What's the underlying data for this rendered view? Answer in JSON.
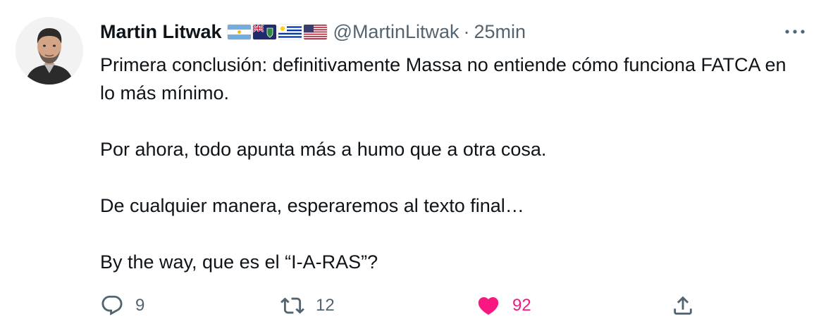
{
  "user": {
    "name": "Martin Litwak",
    "flags": [
      {
        "name": "argentina-flag-icon",
        "country": "Argentina"
      },
      {
        "name": "british-virgin-islands-flag-icon",
        "country": "British Virgin Islands"
      },
      {
        "name": "uruguay-flag-icon",
        "country": "Uruguay"
      },
      {
        "name": "united-states-flag-icon",
        "country": "United States"
      }
    ],
    "handle": "@MartinLitwak",
    "separator": "·",
    "time": "25min"
  },
  "tweet": {
    "paragraphs": [
      "Primera conclusión: definitivamente Massa no entiende cómo funciona FATCA en lo más mínimo.",
      "Por ahora, todo apunta más a humo que a otra cosa.",
      "De cualquier manera, esperaremos al texto final…",
      "By the way, que es el “I-A-RAS”?"
    ]
  },
  "actions": {
    "reply_count": "9",
    "retweet_count": "12",
    "like_count": "92",
    "liked": true
  },
  "colors": {
    "text": "#0f1419",
    "secondary": "#536471",
    "like": "#f91880"
  },
  "icons": {
    "more": "more-icon",
    "reply": "reply-icon",
    "retweet": "retweet-icon",
    "like": "heart-icon",
    "share": "share-icon"
  }
}
